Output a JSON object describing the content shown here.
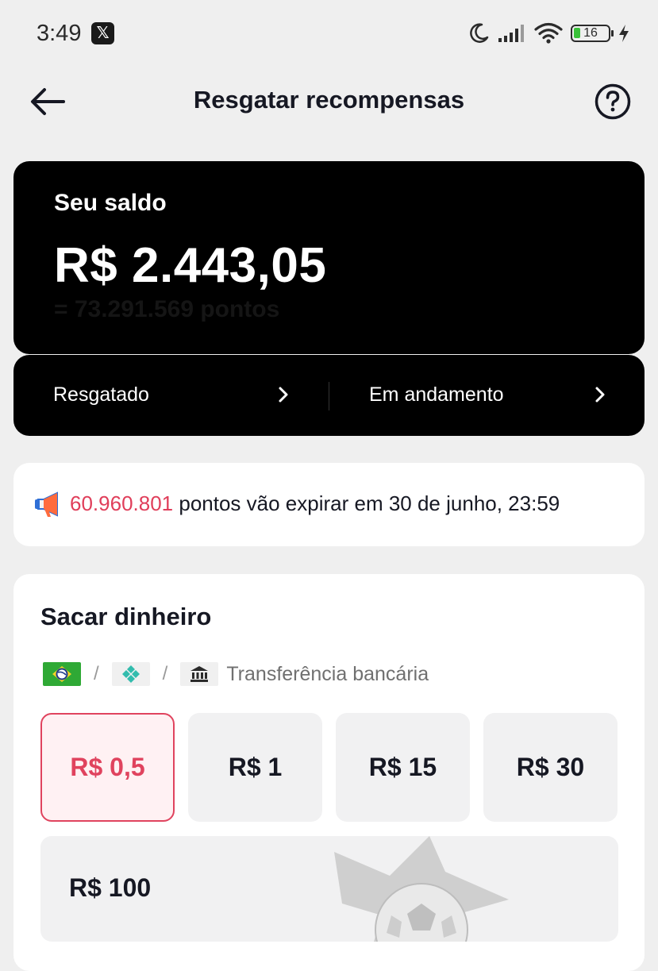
{
  "status_bar": {
    "time": "3:49",
    "notification_icon": "x-logo-icon",
    "battery_level": "16",
    "icons": [
      "moon-icon",
      "signal-icon",
      "wifi-icon",
      "battery-icon",
      "charging-bolt-icon"
    ]
  },
  "header": {
    "title": "Resgatar recompensas",
    "back_icon": "back-arrow-icon",
    "help_icon": "help-question-icon"
  },
  "balance": {
    "label": "Seu saldo",
    "value": "R$ 2.443,05",
    "points": "= 73.291.569 pontos"
  },
  "history": {
    "redeemed": "Resgatado",
    "in_progress": "Em andamento"
  },
  "expiry": {
    "points": "60.960.801",
    "text": " pontos vão expirar em 30 de junho, 23:59",
    "highlight_color": "#e03e5a"
  },
  "withdraw": {
    "title": "Sacar dinheiro",
    "methods": [
      "pix-brazil-icon",
      "pix-diamond-icon",
      "bank-icon"
    ],
    "method_separator": "/",
    "bank_label": "Transferência bancária",
    "amounts": [
      "R$ 0,5",
      "R$ 1",
      "R$ 15",
      "R$ 30"
    ],
    "selected_amount": "R$ 0,5",
    "large_amount": "R$ 100",
    "accent_color": "#e0435e"
  }
}
